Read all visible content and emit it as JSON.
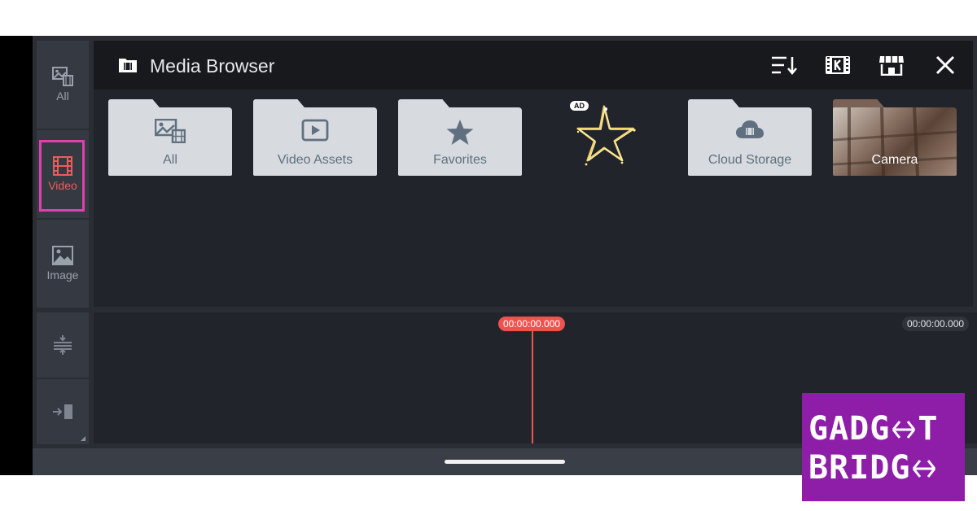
{
  "sidebar": {
    "items": [
      {
        "label": "All",
        "icon": "media-all-icon"
      },
      {
        "label": "Video",
        "icon": "film-icon",
        "active": true
      },
      {
        "label": "Image",
        "icon": "image-icon"
      }
    ],
    "tools": [
      {
        "icon": "split-layers-icon"
      },
      {
        "icon": "import-into-icon"
      }
    ]
  },
  "header": {
    "title": "Media Browser",
    "icons": [
      "sort-icon",
      "kinemaster-k-icon",
      "store-icon",
      "close-icon"
    ]
  },
  "folders": [
    {
      "label": "All",
      "icon": "media-all-icon"
    },
    {
      "label": "Video Assets",
      "icon": "play-icon"
    },
    {
      "label": "Favorites",
      "icon": "star-icon"
    },
    {
      "label": "Cloud Storage",
      "icon": "cloud-film-icon"
    },
    {
      "label": "Camera",
      "icon": "photo-thumbnail"
    }
  ],
  "ad": {
    "badge": "AD",
    "icon": "sparkler-star-icon"
  },
  "timeline": {
    "current_time": "00:00:00.000",
    "total_time": "00:00:00.000"
  },
  "colors": {
    "accent": "#ef5350",
    "highlight": "#e03fb0",
    "panel": "#21252b",
    "header": "#17191d"
  },
  "watermark": {
    "line1": "GADG",
    "line1_end": "T",
    "line2": "BRIDG"
  }
}
